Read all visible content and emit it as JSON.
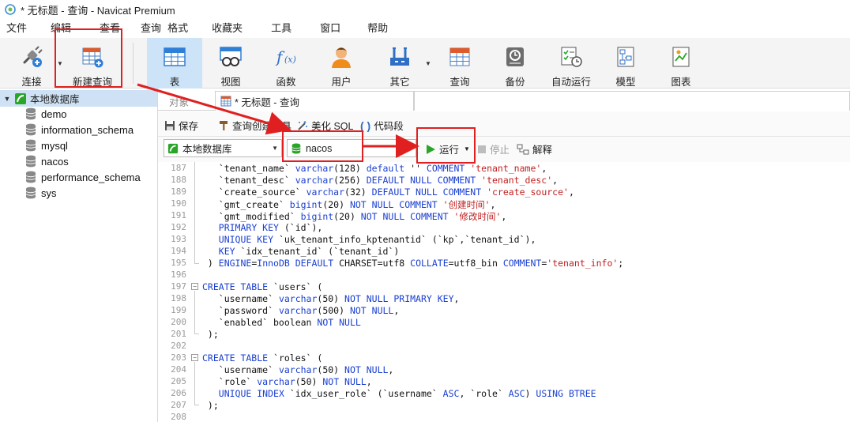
{
  "window": {
    "title": "* 无标题 - 查询 - Navicat Premium"
  },
  "menu": [
    "文件",
    "编辑",
    "查看",
    "查询",
    "格式",
    "收藏夹",
    "工具",
    "窗口",
    "帮助"
  ],
  "toolbar": {
    "connect": "连接",
    "new_query": "新建查询",
    "table": "表",
    "view": "视图",
    "function": "函数",
    "user": "用户",
    "other": "其它",
    "query": "查询",
    "backup": "备份",
    "automation": "自动运行",
    "model": "模型",
    "chart": "图表"
  },
  "sidebar": {
    "root": "本地数据库",
    "databases": [
      "demo",
      "information_schema",
      "mysql",
      "nacos",
      "performance_schema",
      "sys"
    ]
  },
  "tabs": {
    "objects": "对象",
    "query_tab": "* 无标题 - 查询"
  },
  "query_toolbar": {
    "save": "保存",
    "query_builder": "查询创建工具",
    "beautify": "美化 SQL",
    "snippet": "代码段"
  },
  "selectors": {
    "connection": "本地数据库",
    "database": "nacos"
  },
  "run": {
    "run": "运行",
    "stop": "停止",
    "explain": "解释"
  },
  "editor": {
    "lines": [
      {
        "n": "187",
        "code": [
          [
            "p",
            "   `tenant_name` "
          ],
          [
            "t",
            "varchar"
          ],
          [
            "p",
            "(128) "
          ],
          [
            "k",
            "default"
          ],
          [
            "p",
            " '' "
          ],
          [
            "k",
            "COMMENT"
          ],
          [
            "p",
            " "
          ],
          [
            "s",
            "'tenant_name'"
          ],
          [
            "p",
            ","
          ]
        ]
      },
      {
        "n": "188",
        "code": [
          [
            "p",
            "   `tenant_desc` "
          ],
          [
            "t",
            "varchar"
          ],
          [
            "p",
            "(256) "
          ],
          [
            "k",
            "DEFAULT NULL COMMENT"
          ],
          [
            "p",
            " "
          ],
          [
            "s",
            "'tenant_desc'"
          ],
          [
            "p",
            ","
          ]
        ]
      },
      {
        "n": "189",
        "code": [
          [
            "p",
            "   `create_source` "
          ],
          [
            "t",
            "varchar"
          ],
          [
            "p",
            "(32) "
          ],
          [
            "k",
            "DEFAULT NULL COMMENT"
          ],
          [
            "p",
            " "
          ],
          [
            "s",
            "'create_source'"
          ],
          [
            "p",
            ","
          ]
        ]
      },
      {
        "n": "190",
        "code": [
          [
            "p",
            "   `gmt_create` "
          ],
          [
            "t",
            "bigint"
          ],
          [
            "p",
            "(20) "
          ],
          [
            "k",
            "NOT NULL COMMENT"
          ],
          [
            "p",
            " "
          ],
          [
            "s",
            "'创建时间'"
          ],
          [
            "p",
            ","
          ]
        ]
      },
      {
        "n": "191",
        "code": [
          [
            "p",
            "   `gmt_modified` "
          ],
          [
            "t",
            "bigint"
          ],
          [
            "p",
            "(20) "
          ],
          [
            "k",
            "NOT NULL COMMENT"
          ],
          [
            "p",
            " "
          ],
          [
            "s",
            "'修改时间'"
          ],
          [
            "p",
            ","
          ]
        ]
      },
      {
        "n": "192",
        "code": [
          [
            "p",
            "   "
          ],
          [
            "k",
            "PRIMARY KEY"
          ],
          [
            "p",
            " (`id`),"
          ]
        ]
      },
      {
        "n": "193",
        "code": [
          [
            "p",
            "   "
          ],
          [
            "k",
            "UNIQUE KEY"
          ],
          [
            "p",
            " `uk_tenant_info_kptenantid` (`kp`,`tenant_id`),"
          ]
        ]
      },
      {
        "n": "194",
        "code": [
          [
            "p",
            "   "
          ],
          [
            "k",
            "KEY"
          ],
          [
            "p",
            " `idx_tenant_id` (`tenant_id`)"
          ]
        ]
      },
      {
        "n": "195",
        "code": [
          [
            "p",
            " ) "
          ],
          [
            "k",
            "ENGINE"
          ],
          [
            "p",
            "="
          ],
          [
            "k",
            "InnoDB"
          ],
          [
            "p",
            " "
          ],
          [
            "k",
            "DEFAULT"
          ],
          [
            "p",
            " CHARSET=utf8 "
          ],
          [
            "k",
            "COLLATE"
          ],
          [
            "p",
            "=utf8_bin "
          ],
          [
            "k",
            "COMMENT"
          ],
          [
            "p",
            "="
          ],
          [
            "s",
            "'tenant_info'"
          ],
          [
            "p",
            ";"
          ]
        ]
      },
      {
        "n": "196",
        "code": []
      },
      {
        "n": "197",
        "code": [
          [
            "k",
            "CREATE TABLE"
          ],
          [
            "p",
            " `users` ("
          ]
        ]
      },
      {
        "n": "198",
        "code": [
          [
            "p",
            "   `username` "
          ],
          [
            "t",
            "varchar"
          ],
          [
            "p",
            "(50) "
          ],
          [
            "k",
            "NOT NULL PRIMARY KEY"
          ],
          [
            "p",
            ","
          ]
        ]
      },
      {
        "n": "199",
        "code": [
          [
            "p",
            "   `password` "
          ],
          [
            "t",
            "varchar"
          ],
          [
            "p",
            "(500) "
          ],
          [
            "k",
            "NOT NULL"
          ],
          [
            "p",
            ","
          ]
        ]
      },
      {
        "n": "200",
        "code": [
          [
            "p",
            "   `enabled` boolean "
          ],
          [
            "k",
            "NOT NULL"
          ]
        ]
      },
      {
        "n": "201",
        "code": [
          [
            "p",
            " );"
          ]
        ]
      },
      {
        "n": "202",
        "code": []
      },
      {
        "n": "203",
        "code": [
          [
            "k",
            "CREATE TABLE"
          ],
          [
            "p",
            " `roles` ("
          ]
        ]
      },
      {
        "n": "204",
        "code": [
          [
            "p",
            "   `username` "
          ],
          [
            "t",
            "varchar"
          ],
          [
            "p",
            "(50) "
          ],
          [
            "k",
            "NOT NULL"
          ],
          [
            "p",
            ","
          ]
        ]
      },
      {
        "n": "205",
        "code": [
          [
            "p",
            "   `role` "
          ],
          [
            "t",
            "varchar"
          ],
          [
            "p",
            "(50) "
          ],
          [
            "k",
            "NOT NULL"
          ],
          [
            "p",
            ","
          ]
        ]
      },
      {
        "n": "206",
        "code": [
          [
            "p",
            "   "
          ],
          [
            "k",
            "UNIQUE INDEX"
          ],
          [
            "p",
            " `idx_user_role` (`username` "
          ],
          [
            "k",
            "ASC"
          ],
          [
            "p",
            ", `role` "
          ],
          [
            "k",
            "ASC"
          ],
          [
            "p",
            ") "
          ],
          [
            "k",
            "USING BTREE"
          ]
        ]
      },
      {
        "n": "207",
        "code": [
          [
            "p",
            " );"
          ]
        ]
      },
      {
        "n": "208",
        "code": []
      }
    ]
  },
  "colors": {
    "annotation_red": "#e02020",
    "active_tool_bg": "#cde3f7",
    "run_green": "#2aa52a"
  }
}
